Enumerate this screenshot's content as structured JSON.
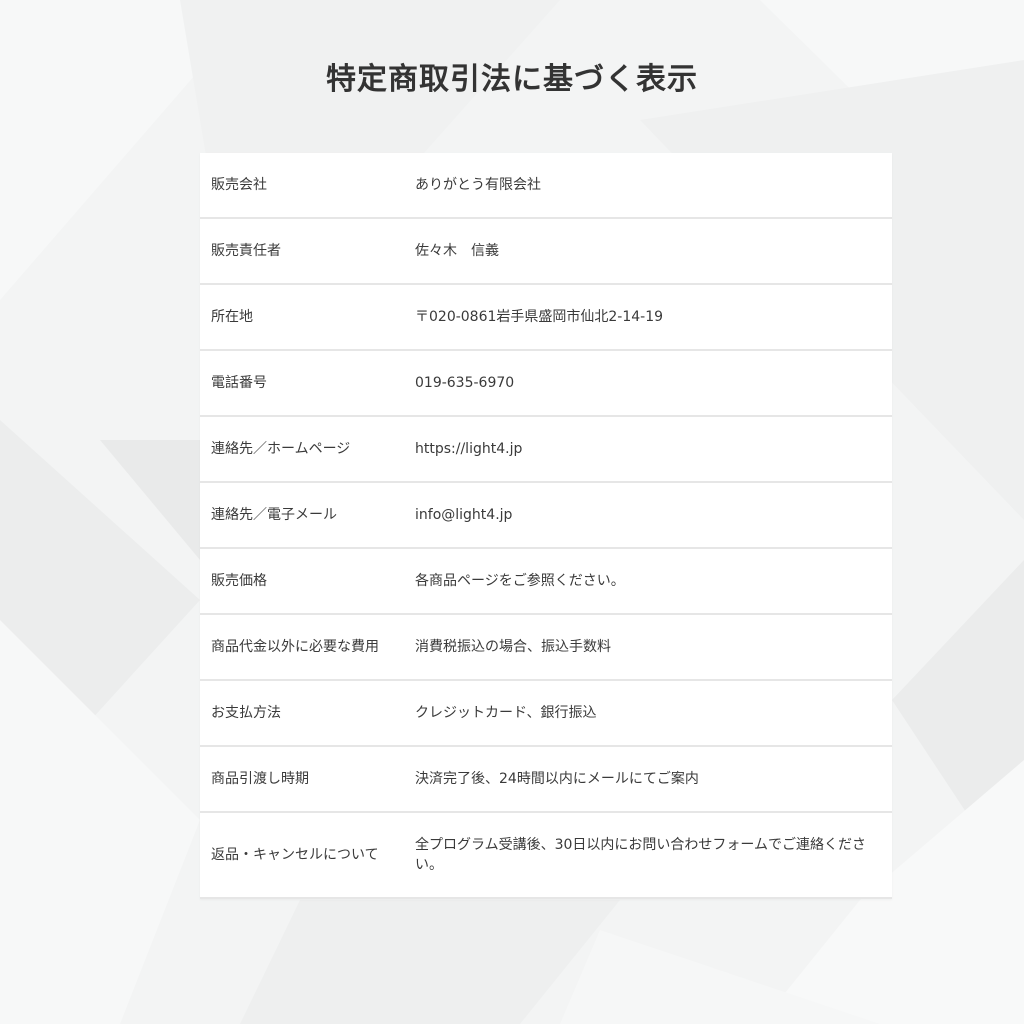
{
  "page": {
    "title": "特定商取引法に基づく表示"
  },
  "table": {
    "rows": [
      {
        "label": "販売会社",
        "value": "ありがとう有限会社"
      },
      {
        "label": "販売責任者",
        "value": "佐々木　信義"
      },
      {
        "label": "所在地",
        "value": "〒020-0861岩手県盛岡市仙北2-14-19"
      },
      {
        "label": "電話番号",
        "value": "019-635-6970"
      },
      {
        "label": "連絡先／ホームページ",
        "value": "https://light4.jp"
      },
      {
        "label": "連絡先／電子メール",
        "value": "info@light4.jp"
      },
      {
        "label": "販売価格",
        "value": "各商品ページをご参照ください。"
      },
      {
        "label": "商品代金以外に必要な費用",
        "value": "消費税振込の場合、振込手数料"
      },
      {
        "label": "お支払方法",
        "value": "クレジットカード、銀行振込"
      },
      {
        "label": "商品引渡し時期",
        "value": "決済完了後、24時間以内にメールにてご案内"
      },
      {
        "label": "返品・キャンセルについて",
        "value": "全プログラム受講後、30日以内にお問い合わせフォームでご連絡ください。"
      }
    ]
  },
  "colors": {
    "background": "#f3f4f4",
    "table_background": "#ffffff",
    "row_divider": "#e6e6e6",
    "text": "#333333"
  }
}
